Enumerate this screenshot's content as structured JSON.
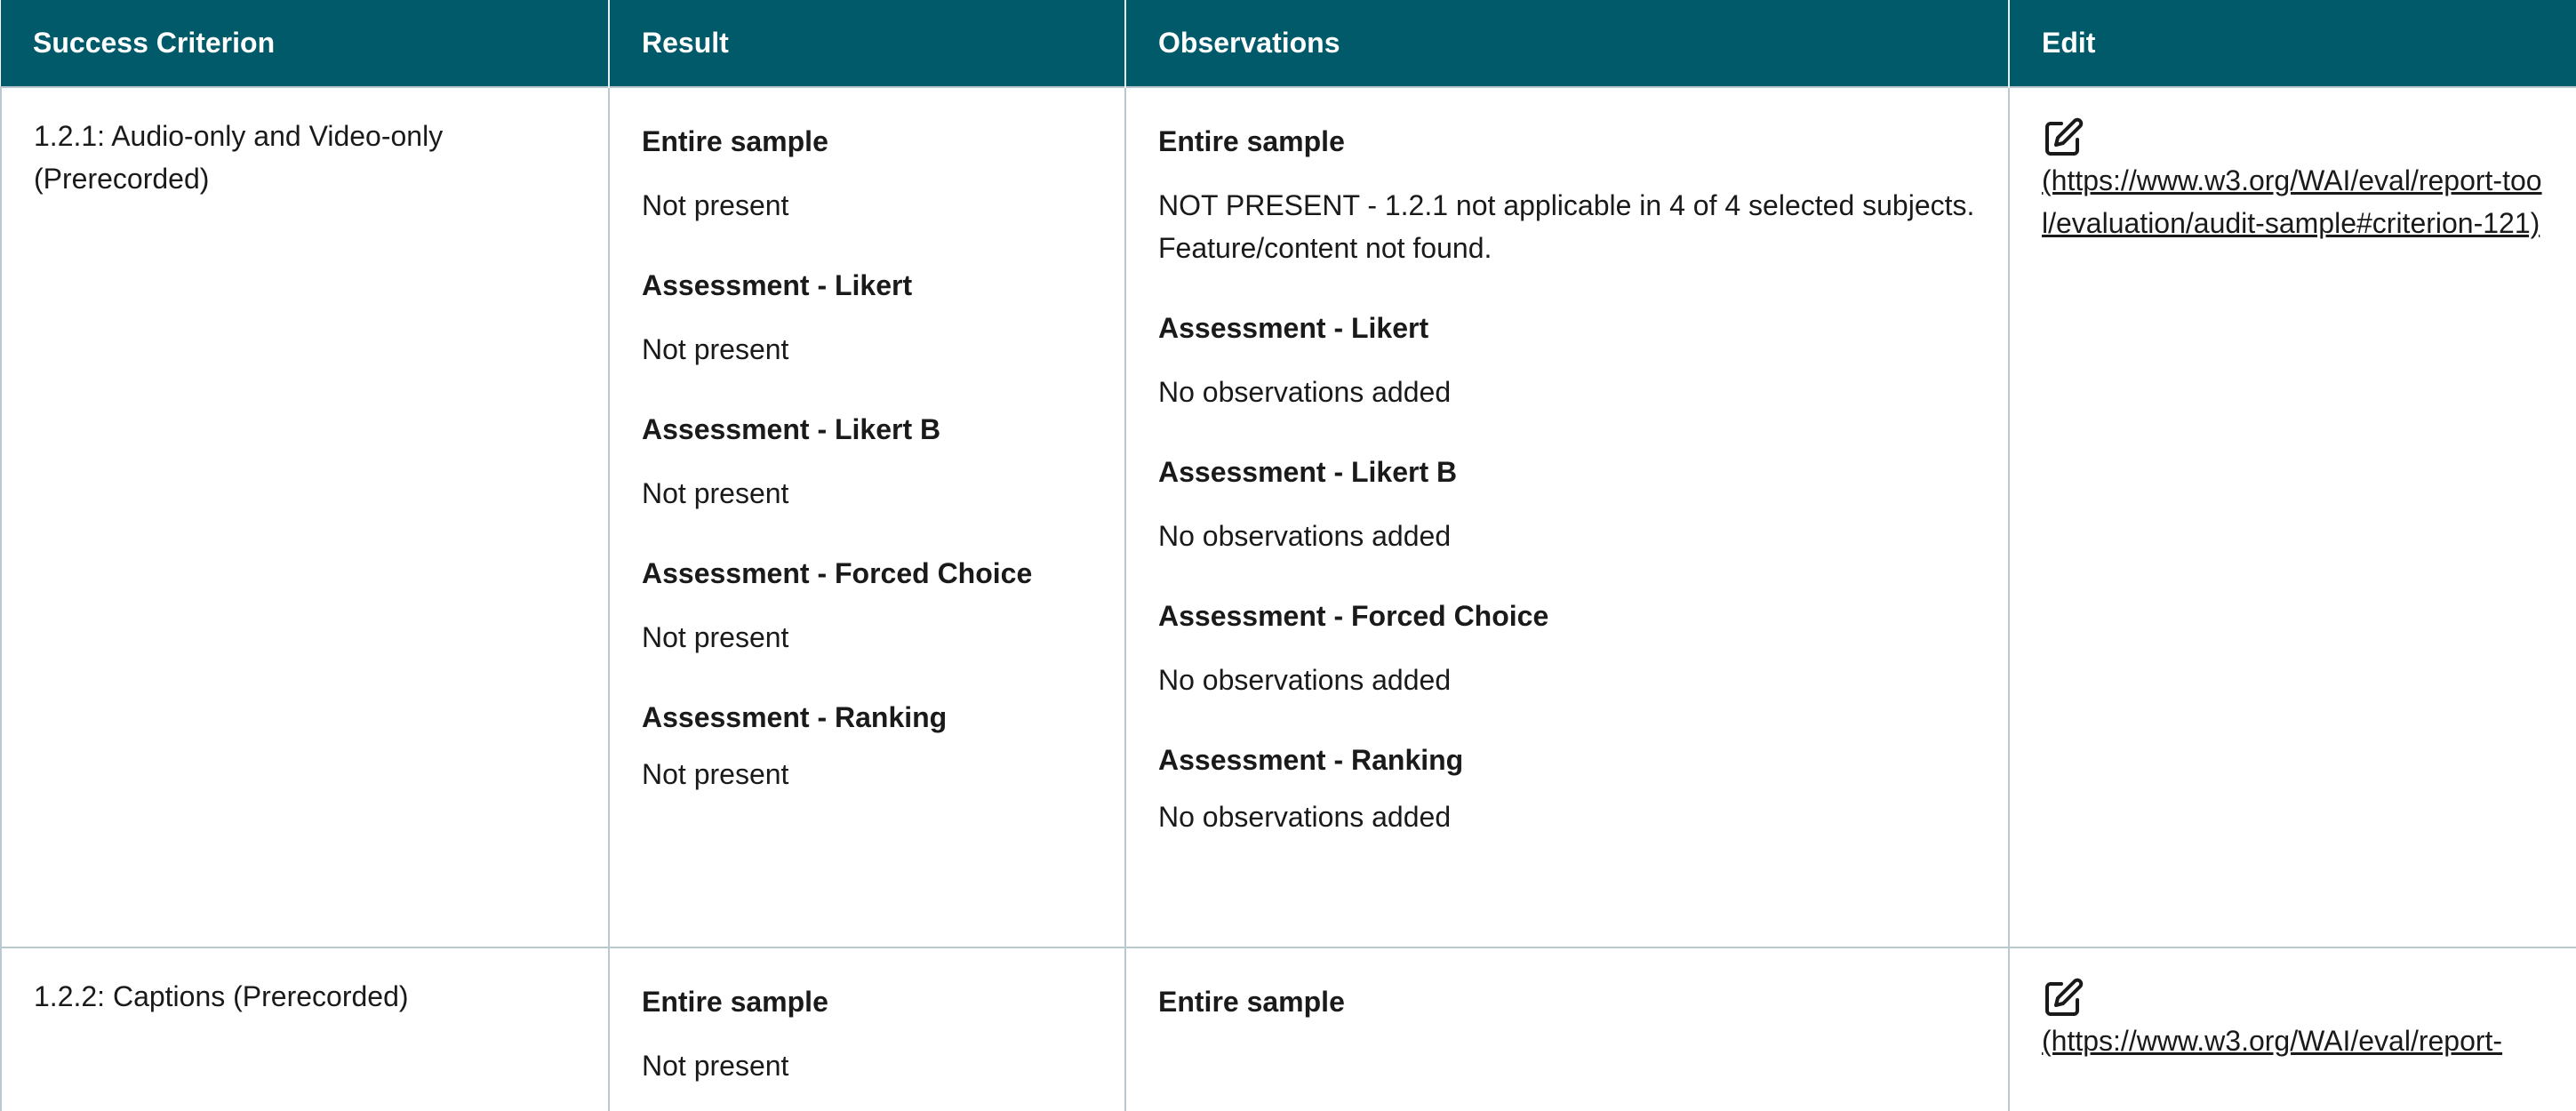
{
  "table": {
    "headers": [
      "Success Criterion",
      "Result",
      "Observations",
      "Edit"
    ],
    "rows": [
      {
        "criterion": "1.2.1: Audio-only and Video-only (Prerecorded)",
        "results": [
          {
            "title": "Entire sample",
            "value": "Not present"
          },
          {
            "title": "Assessment - Likert",
            "value": "Not present"
          },
          {
            "title": "Assessment - Likert B",
            "value": "Not present"
          },
          {
            "title": "Assessment - Forced Choice",
            "value": "Not present"
          },
          {
            "title": "Assessment - Ranking",
            "value": "Not present"
          }
        ],
        "observations": [
          {
            "title": "Entire sample",
            "value": "NOT PRESENT - 1.2.1 not applicable in 4 of 4 selected subjects. Feature/content not found."
          },
          {
            "title": "Assessment - Likert",
            "value": "No observations added"
          },
          {
            "title": "Assessment - Likert B",
            "value": "No observations added"
          },
          {
            "title": "Assessment - Forced Choice",
            "value": "No observations added"
          },
          {
            "title": "Assessment - Ranking",
            "value": "No observations added"
          }
        ],
        "edit_icon": "edit-icon",
        "edit_link": "(https://www.w3.org/WAI/eval/report-tool/evaluation/audit-sample#criterion-121)"
      },
      {
        "criterion": "1.2.2: Captions (Prerecorded)",
        "results": [
          {
            "title": "Entire sample",
            "value": "Not present"
          }
        ],
        "observations": [
          {
            "title": "Entire sample",
            "value": ""
          }
        ],
        "edit_icon": "edit-icon",
        "edit_link": "(https://www.w3.org/WAI/eval/report-"
      }
    ]
  },
  "colors": {
    "header_bg": "#005a6a",
    "header_text": "#ffffff",
    "border": "#b8c9cf"
  }
}
